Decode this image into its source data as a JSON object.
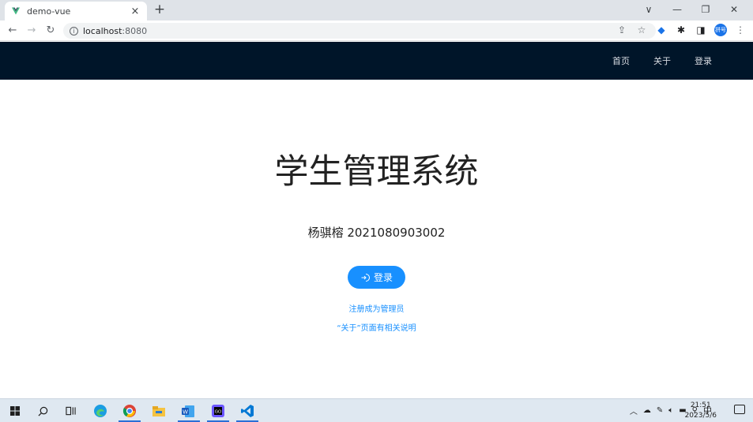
{
  "browser": {
    "tab_title": "demo-vue",
    "tab_close": "×",
    "new_tab": "+",
    "url_host": "localhost",
    "url_port": ":8080",
    "profile_text": "拼号",
    "window_controls": [
      "∨",
      "—",
      "❐",
      "✕"
    ]
  },
  "nav": {
    "items": [
      "首页",
      "关于",
      "登录"
    ]
  },
  "main": {
    "title": "学生管理系统",
    "student": "杨骐榕 2021080903002",
    "login_button": "登录",
    "register_link": "注册成为管理员",
    "about_link": "“关于”页面有相关说明"
  },
  "taskbar": {
    "time": "21:51",
    "date": "2023/5/6",
    "ime": "中"
  },
  "colors": {
    "header_bg": "#001529",
    "primary": "#1890ff",
    "vue_green": "#42b883"
  }
}
